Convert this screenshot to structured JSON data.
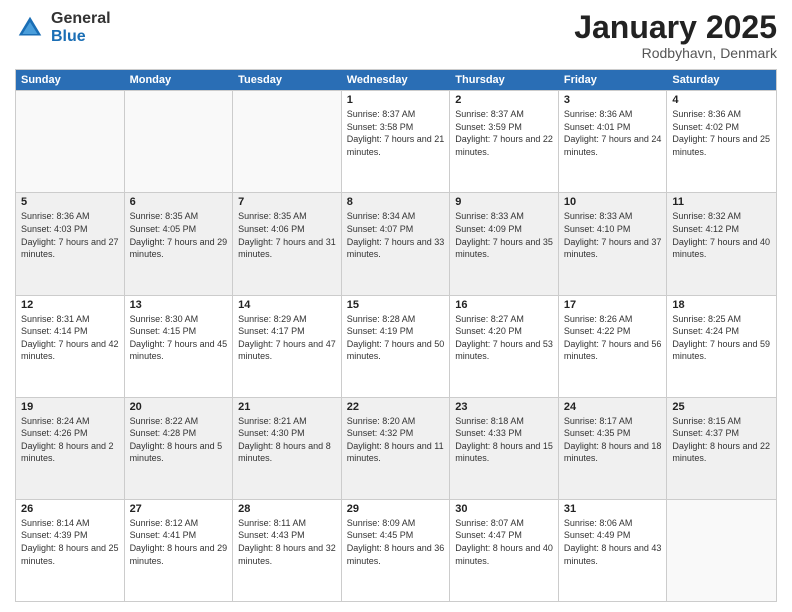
{
  "logo": {
    "general": "General",
    "blue": "Blue"
  },
  "header": {
    "month": "January 2025",
    "location": "Rodbyhavn, Denmark"
  },
  "days": [
    "Sunday",
    "Monday",
    "Tuesday",
    "Wednesday",
    "Thursday",
    "Friday",
    "Saturday"
  ],
  "rows": [
    [
      {
        "day": "",
        "sunrise": "",
        "sunset": "",
        "daylight": "",
        "empty": true
      },
      {
        "day": "",
        "sunrise": "",
        "sunset": "",
        "daylight": "",
        "empty": true
      },
      {
        "day": "",
        "sunrise": "",
        "sunset": "",
        "daylight": "",
        "empty": true
      },
      {
        "day": "1",
        "sunrise": "Sunrise: 8:37 AM",
        "sunset": "Sunset: 3:58 PM",
        "daylight": "Daylight: 7 hours and 21 minutes."
      },
      {
        "day": "2",
        "sunrise": "Sunrise: 8:37 AM",
        "sunset": "Sunset: 3:59 PM",
        "daylight": "Daylight: 7 hours and 22 minutes."
      },
      {
        "day": "3",
        "sunrise": "Sunrise: 8:36 AM",
        "sunset": "Sunset: 4:01 PM",
        "daylight": "Daylight: 7 hours and 24 minutes."
      },
      {
        "day": "4",
        "sunrise": "Sunrise: 8:36 AM",
        "sunset": "Sunset: 4:02 PM",
        "daylight": "Daylight: 7 hours and 25 minutes."
      }
    ],
    [
      {
        "day": "5",
        "sunrise": "Sunrise: 8:36 AM",
        "sunset": "Sunset: 4:03 PM",
        "daylight": "Daylight: 7 hours and 27 minutes."
      },
      {
        "day": "6",
        "sunrise": "Sunrise: 8:35 AM",
        "sunset": "Sunset: 4:05 PM",
        "daylight": "Daylight: 7 hours and 29 minutes."
      },
      {
        "day": "7",
        "sunrise": "Sunrise: 8:35 AM",
        "sunset": "Sunset: 4:06 PM",
        "daylight": "Daylight: 7 hours and 31 minutes."
      },
      {
        "day": "8",
        "sunrise": "Sunrise: 8:34 AM",
        "sunset": "Sunset: 4:07 PM",
        "daylight": "Daylight: 7 hours and 33 minutes."
      },
      {
        "day": "9",
        "sunrise": "Sunrise: 8:33 AM",
        "sunset": "Sunset: 4:09 PM",
        "daylight": "Daylight: 7 hours and 35 minutes."
      },
      {
        "day": "10",
        "sunrise": "Sunrise: 8:33 AM",
        "sunset": "Sunset: 4:10 PM",
        "daylight": "Daylight: 7 hours and 37 minutes."
      },
      {
        "day": "11",
        "sunrise": "Sunrise: 8:32 AM",
        "sunset": "Sunset: 4:12 PM",
        "daylight": "Daylight: 7 hours and 40 minutes."
      }
    ],
    [
      {
        "day": "12",
        "sunrise": "Sunrise: 8:31 AM",
        "sunset": "Sunset: 4:14 PM",
        "daylight": "Daylight: 7 hours and 42 minutes."
      },
      {
        "day": "13",
        "sunrise": "Sunrise: 8:30 AM",
        "sunset": "Sunset: 4:15 PM",
        "daylight": "Daylight: 7 hours and 45 minutes."
      },
      {
        "day": "14",
        "sunrise": "Sunrise: 8:29 AM",
        "sunset": "Sunset: 4:17 PM",
        "daylight": "Daylight: 7 hours and 47 minutes."
      },
      {
        "day": "15",
        "sunrise": "Sunrise: 8:28 AM",
        "sunset": "Sunset: 4:19 PM",
        "daylight": "Daylight: 7 hours and 50 minutes."
      },
      {
        "day": "16",
        "sunrise": "Sunrise: 8:27 AM",
        "sunset": "Sunset: 4:20 PM",
        "daylight": "Daylight: 7 hours and 53 minutes."
      },
      {
        "day": "17",
        "sunrise": "Sunrise: 8:26 AM",
        "sunset": "Sunset: 4:22 PM",
        "daylight": "Daylight: 7 hours and 56 minutes."
      },
      {
        "day": "18",
        "sunrise": "Sunrise: 8:25 AM",
        "sunset": "Sunset: 4:24 PM",
        "daylight": "Daylight: 7 hours and 59 minutes."
      }
    ],
    [
      {
        "day": "19",
        "sunrise": "Sunrise: 8:24 AM",
        "sunset": "Sunset: 4:26 PM",
        "daylight": "Daylight: 8 hours and 2 minutes."
      },
      {
        "day": "20",
        "sunrise": "Sunrise: 8:22 AM",
        "sunset": "Sunset: 4:28 PM",
        "daylight": "Daylight: 8 hours and 5 minutes."
      },
      {
        "day": "21",
        "sunrise": "Sunrise: 8:21 AM",
        "sunset": "Sunset: 4:30 PM",
        "daylight": "Daylight: 8 hours and 8 minutes."
      },
      {
        "day": "22",
        "sunrise": "Sunrise: 8:20 AM",
        "sunset": "Sunset: 4:32 PM",
        "daylight": "Daylight: 8 hours and 11 minutes."
      },
      {
        "day": "23",
        "sunrise": "Sunrise: 8:18 AM",
        "sunset": "Sunset: 4:33 PM",
        "daylight": "Daylight: 8 hours and 15 minutes."
      },
      {
        "day": "24",
        "sunrise": "Sunrise: 8:17 AM",
        "sunset": "Sunset: 4:35 PM",
        "daylight": "Daylight: 8 hours and 18 minutes."
      },
      {
        "day": "25",
        "sunrise": "Sunrise: 8:15 AM",
        "sunset": "Sunset: 4:37 PM",
        "daylight": "Daylight: 8 hours and 22 minutes."
      }
    ],
    [
      {
        "day": "26",
        "sunrise": "Sunrise: 8:14 AM",
        "sunset": "Sunset: 4:39 PM",
        "daylight": "Daylight: 8 hours and 25 minutes."
      },
      {
        "day": "27",
        "sunrise": "Sunrise: 8:12 AM",
        "sunset": "Sunset: 4:41 PM",
        "daylight": "Daylight: 8 hours and 29 minutes."
      },
      {
        "day": "28",
        "sunrise": "Sunrise: 8:11 AM",
        "sunset": "Sunset: 4:43 PM",
        "daylight": "Daylight: 8 hours and 32 minutes."
      },
      {
        "day": "29",
        "sunrise": "Sunrise: 8:09 AM",
        "sunset": "Sunset: 4:45 PM",
        "daylight": "Daylight: 8 hours and 36 minutes."
      },
      {
        "day": "30",
        "sunrise": "Sunrise: 8:07 AM",
        "sunset": "Sunset: 4:47 PM",
        "daylight": "Daylight: 8 hours and 40 minutes."
      },
      {
        "day": "31",
        "sunrise": "Sunrise: 8:06 AM",
        "sunset": "Sunset: 4:49 PM",
        "daylight": "Daylight: 8 hours and 43 minutes."
      },
      {
        "day": "",
        "sunrise": "",
        "sunset": "",
        "daylight": "",
        "empty": true
      }
    ]
  ]
}
